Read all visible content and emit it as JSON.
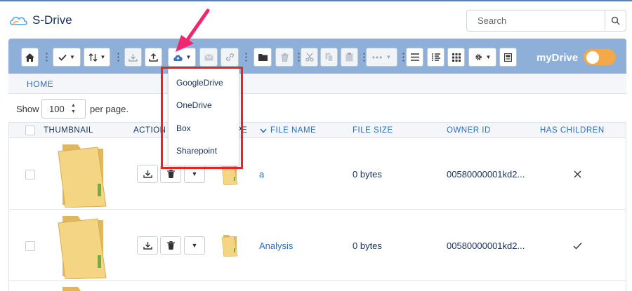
{
  "app": {
    "title": "S-Drive"
  },
  "search": {
    "placeholder": "Search"
  },
  "toolbar": {
    "mydrive_label": "myDrive",
    "mydrive_toggle_on": true,
    "accent_color": "#8eafd8",
    "toggle_color": "#f5a84a"
  },
  "breadcrumb": {
    "home": "HOME"
  },
  "paging": {
    "show_label": "Show",
    "per_page_value": "100",
    "per_page_suffix": "per page."
  },
  "table": {
    "headers": {
      "thumbnail": "THUMBNAIL",
      "actions": "ACTION",
      "type": "PE",
      "file_name": "FILE NAME",
      "file_size": "FILE SIZE",
      "owner_id": "OWNER ID",
      "has_children": "HAS CHILDREN"
    },
    "rows": [
      {
        "file_name": "a",
        "file_size": "0 bytes",
        "owner_id": "00580000001kd2...",
        "has_children_icon": "x-icon"
      },
      {
        "file_name": "Analysis",
        "file_size": "0 bytes",
        "owner_id": "00580000001kd2...",
        "has_children_icon": "check-icon"
      }
    ]
  },
  "cloud_dropdown": {
    "items": [
      "GoogleDrive",
      "OneDrive",
      "Box",
      "Sharepoint"
    ]
  },
  "annotation": {
    "highlight_color": "#e8251d",
    "arrow_color": "#f0266f"
  }
}
